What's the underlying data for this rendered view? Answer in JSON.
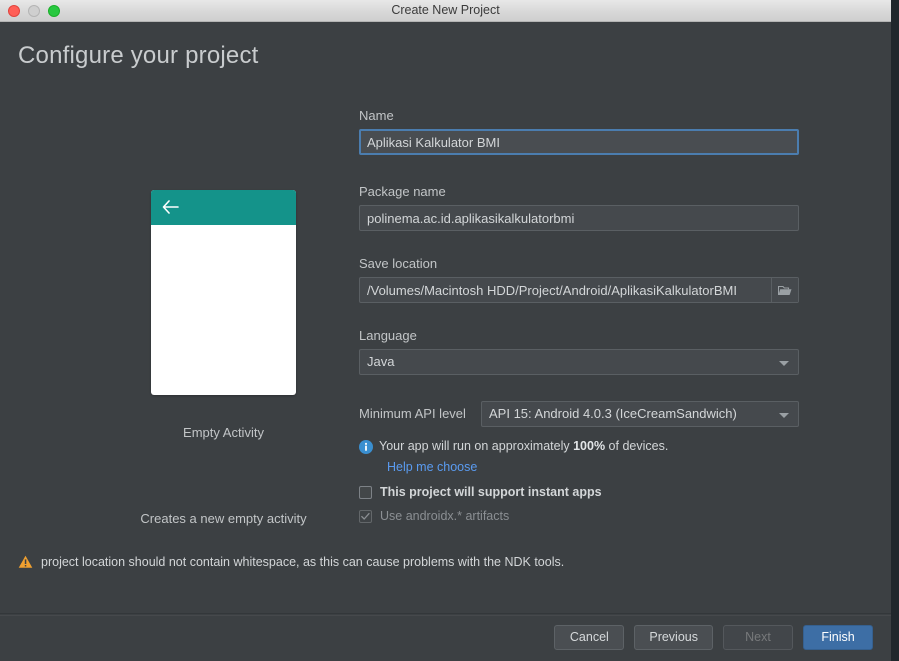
{
  "window": {
    "title": "Create New Project",
    "traffic_lights": [
      "close-red",
      "minimize-gray",
      "zoom-green"
    ]
  },
  "heading": "Configure your project",
  "preview": {
    "icon": "back-arrow-icon",
    "accent_color": "#14938a",
    "title": "Empty Activity",
    "description": "Creates a new empty activity"
  },
  "form": {
    "name": {
      "label": "Name",
      "value": "Aplikasi Kalkulator BMI",
      "focused": true
    },
    "package_name": {
      "label": "Package name",
      "value": "polinema.ac.id.aplikasikalkulatorbmi"
    },
    "save_location": {
      "label": "Save location",
      "value": "/Volumes/Macintosh HDD/Project/Android/AplikasiKalkulatorBMI",
      "browse_icon": "folder-icon"
    },
    "language": {
      "label": "Language",
      "value": "Java"
    },
    "minimum_api_level": {
      "label": "Minimum API level",
      "value": "API 15: Android 4.0.3 (IceCreamSandwich)"
    },
    "device_info": {
      "icon": "info-icon",
      "text_before": "Your app will run on approximately ",
      "percent": "100%",
      "text_after": " of devices.",
      "help_link": "Help me choose"
    },
    "instant_apps_checkbox": {
      "label": "This project will support instant apps",
      "checked": false
    },
    "androidx_checkbox": {
      "label": "Use androidx.* artifacts",
      "checked": true,
      "disabled": true
    }
  },
  "warning": {
    "icon": "warning-triangle-icon",
    "message": "project location should not contain whitespace, as this can cause problems with the NDK tools."
  },
  "footer": {
    "cancel": "Cancel",
    "previous": "Previous",
    "next": "Next",
    "finish": "Finish"
  },
  "colors": {
    "background": "#3c4043",
    "accent_teal": "#14938a",
    "primary_button": "#3d6ea5",
    "link": "#5a9bf0",
    "warning": "#f0a030",
    "info": "#3a8fd0"
  }
}
